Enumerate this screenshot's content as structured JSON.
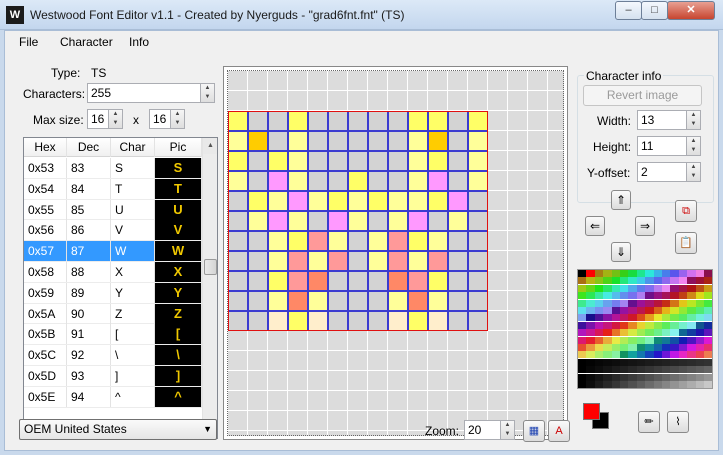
{
  "window": {
    "title": "Westwood Font Editor v1.1 - Created by Nyerguds - \"grad6fnt.fnt\" (TS)",
    "icon_text": "W"
  },
  "window_buttons": {
    "minimize": "–",
    "maximize": "□",
    "close": "✕"
  },
  "menu": {
    "file": "File",
    "character": "Character",
    "info": "Info"
  },
  "font_props": {
    "type_label": "Type:",
    "type_value": "TS",
    "characters_label": "Characters:",
    "characters_value": "255",
    "maxsize_label": "Max size:",
    "max_width": "16",
    "x_label": "x",
    "max_height": "16"
  },
  "table": {
    "headers": [
      "Hex",
      "Dec",
      "Char",
      "Pic"
    ],
    "rows": [
      {
        "hex": "0x53",
        "dec": "83",
        "char": "S",
        "pic": "S"
      },
      {
        "hex": "0x54",
        "dec": "84",
        "char": "T",
        "pic": "T"
      },
      {
        "hex": "0x55",
        "dec": "85",
        "char": "U",
        "pic": "U"
      },
      {
        "hex": "0x56",
        "dec": "86",
        "char": "V",
        "pic": "V"
      },
      {
        "hex": "0x57",
        "dec": "87",
        "char": "W",
        "pic": "W"
      },
      {
        "hex": "0x58",
        "dec": "88",
        "char": "X",
        "pic": "X"
      },
      {
        "hex": "0x59",
        "dec": "89",
        "char": "Y",
        "pic": "Y"
      },
      {
        "hex": "0x5A",
        "dec": "90",
        "char": "Z",
        "pic": "Z"
      },
      {
        "hex": "0x5B",
        "dec": "91",
        "char": "[",
        "pic": "["
      },
      {
        "hex": "0x5C",
        "dec": "92",
        "char": "\\",
        "pic": "\\"
      },
      {
        "hex": "0x5D",
        "dec": "93",
        "char": "]",
        "pic": "]"
      },
      {
        "hex": "0x5E",
        "dec": "94",
        "char": "^",
        "pic": "^"
      }
    ],
    "selected_hex": "0x57"
  },
  "glyph": {
    "columns": 13,
    "rows": 11,
    "palette": {
      ".": "#d3d3d3",
      "y": "#ffff66",
      "l": "#ffff99",
      "o": "#ffcc00",
      "p": "#ff99ff",
      "s": "#ff9999",
      "r": "#ff8866",
      "c": "#ffeecc"
    },
    "pixels": [
      "y..y.....yy.y",
      "lo.l.....lo.l",
      "y.yl.....ly.l",
      "l.pl..y..lp.l",
      ".ylplylyllyp.",
      ".lpl.pl.lp.l.",
      "..lysl.lsyl..",
      "..lsls.lsls..",
      "..ysr...rsy..",
      "..lrl...lrl..",
      "..cyc...cyc.."
    ]
  },
  "char_info": {
    "title": "Character info",
    "revert": "Revert image",
    "width_label": "Width:",
    "width": "13",
    "height_label": "Height:",
    "height": "11",
    "yoffset_label": "Y-offset:",
    "yoffset": "2"
  },
  "arrows": {
    "up": "⇑",
    "left": "⇐",
    "right": "⇒",
    "down": "⇓"
  },
  "encoding": "OEM United States",
  "zoom": {
    "label": "Zoom:",
    "value": "20"
  },
  "colors": {
    "foreground": "#ff0000",
    "background": "#000000"
  }
}
